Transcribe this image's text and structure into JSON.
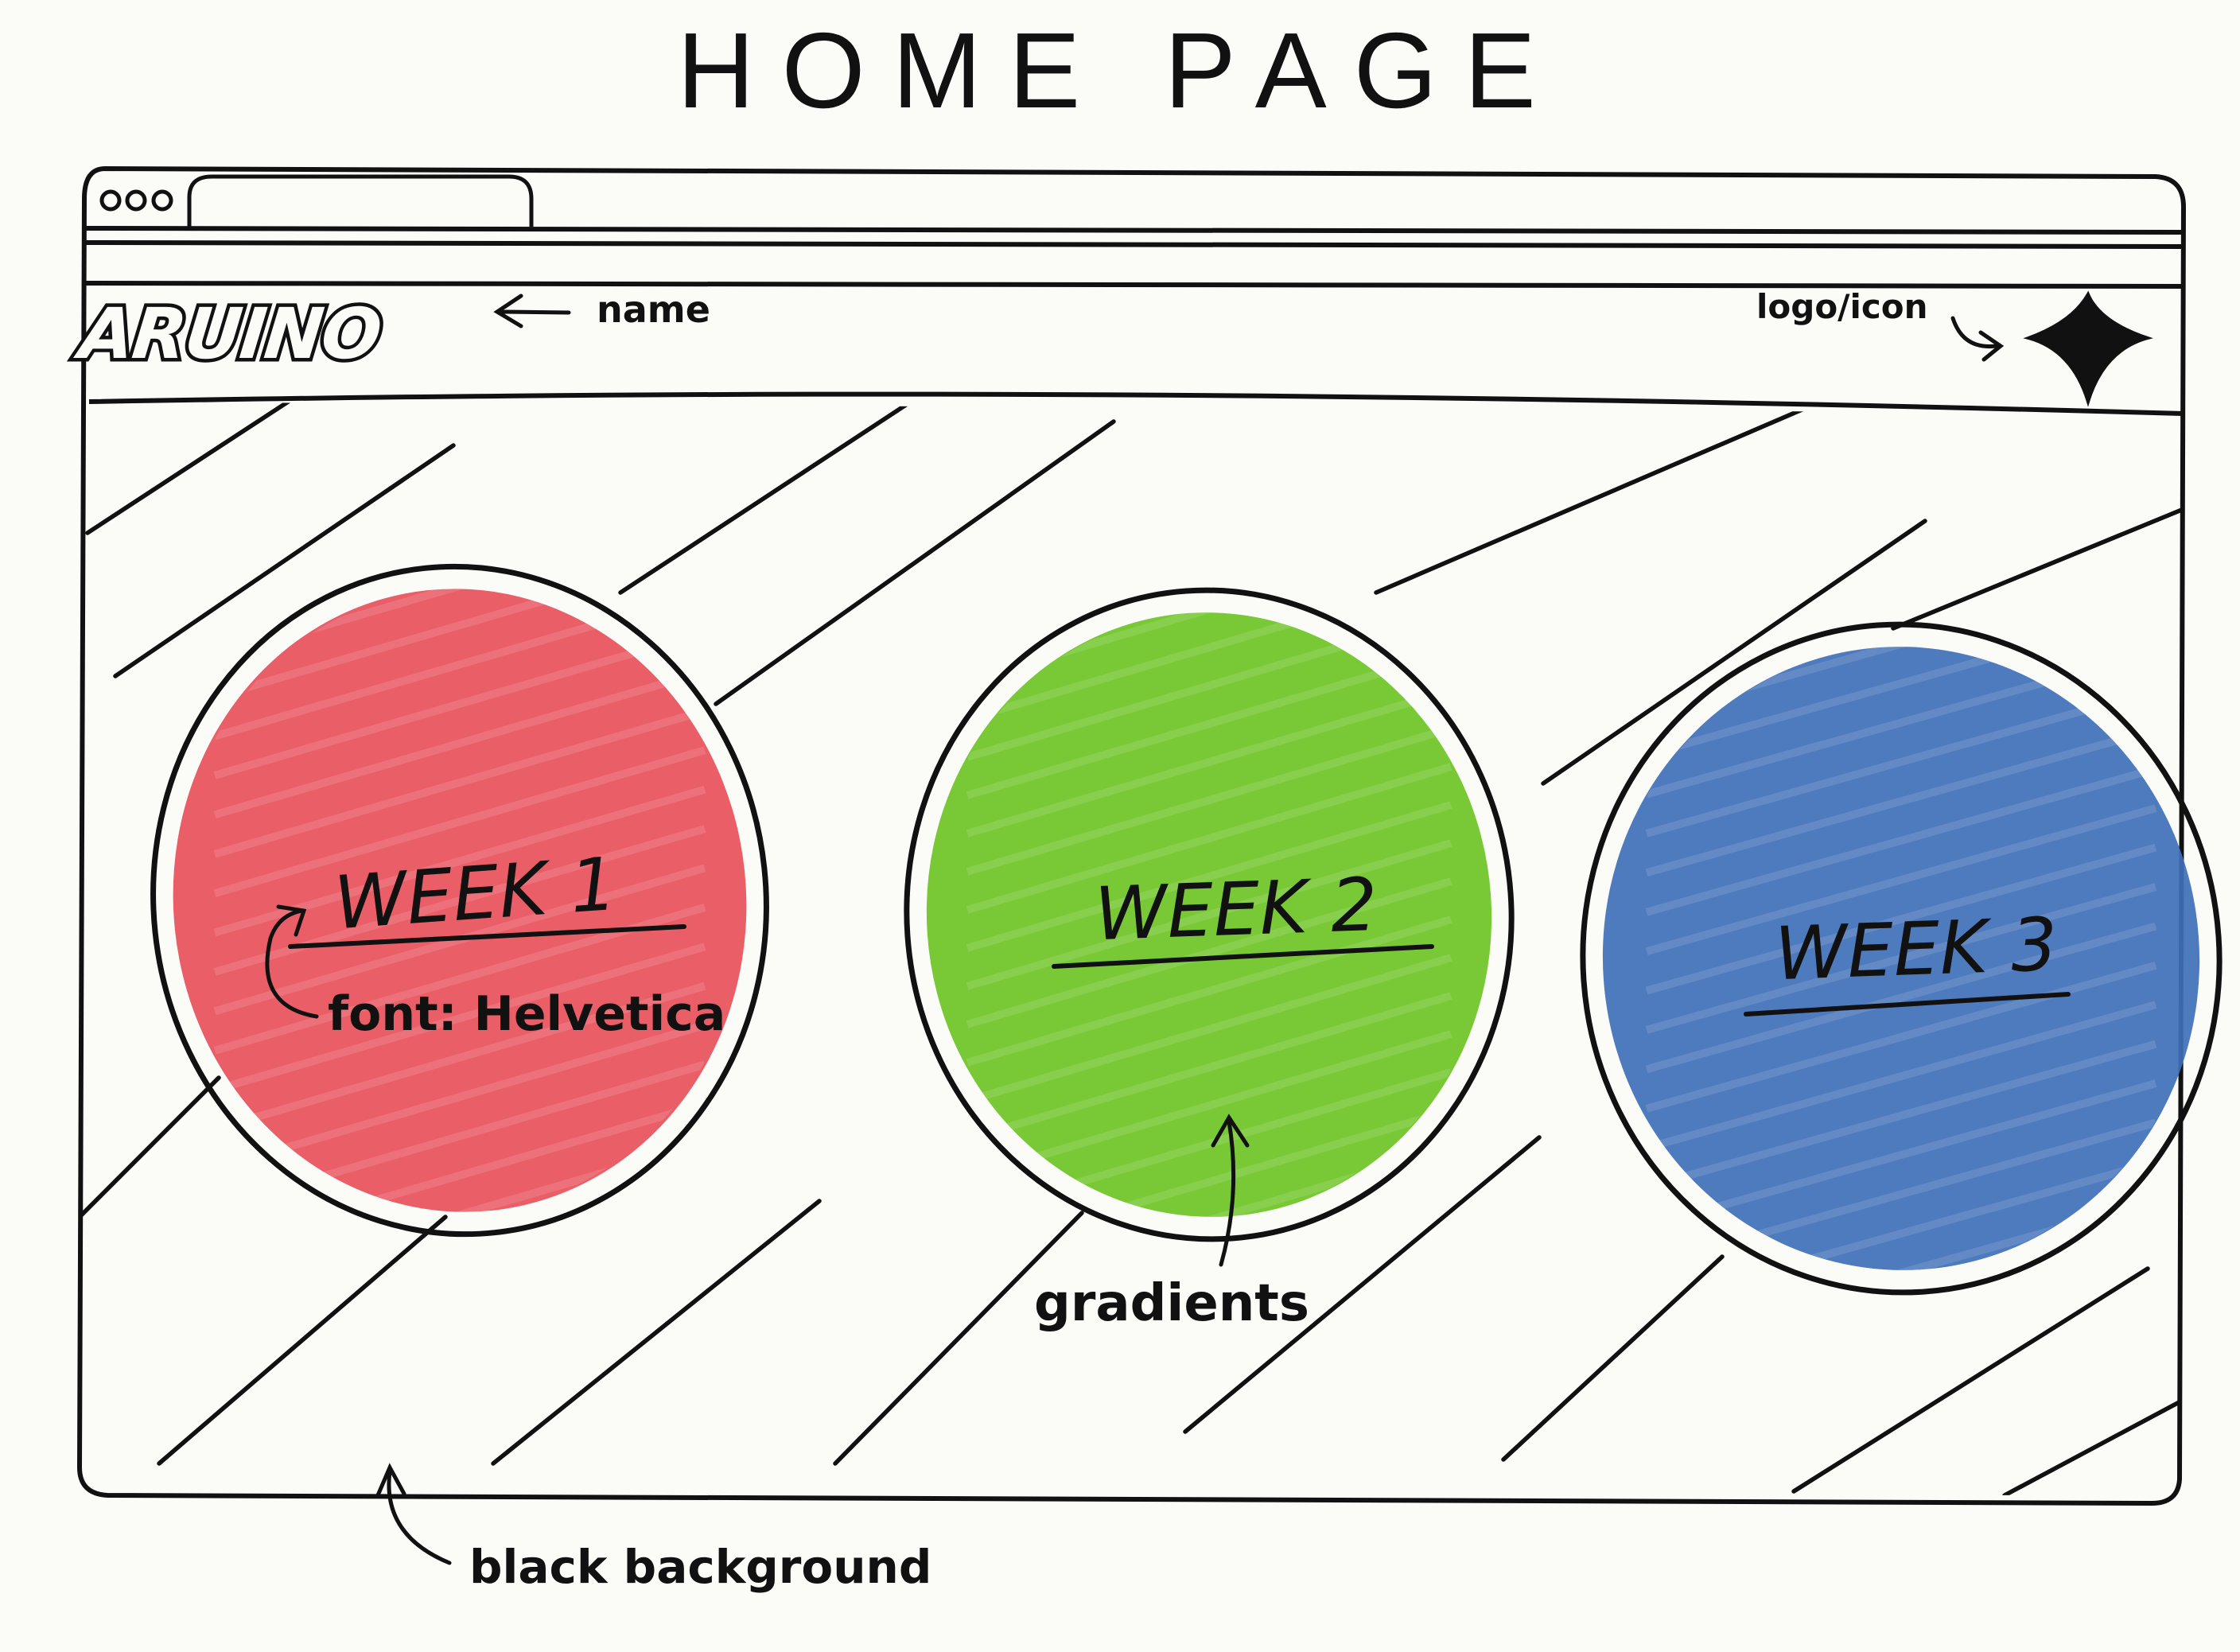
{
  "page_title": "HOME PAGE",
  "header": {
    "brand_name": "ARUINO",
    "brand_annotation": "name",
    "logo_annotation": "logo/icon"
  },
  "circles": [
    {
      "label": "WEEK 1",
      "color": "#e8505b"
    },
    {
      "label": "WEEK 2",
      "color": "#6cc424"
    },
    {
      "label": "WEEK 3",
      "color": "#3f6fb8"
    }
  ],
  "annotations": {
    "font_note": "font: Helvetica",
    "gradients_note": "gradients",
    "background_note": "black background"
  },
  "icons": {
    "window_controls": "three-dot-window-controls",
    "logo": "four-point-star-icon"
  }
}
